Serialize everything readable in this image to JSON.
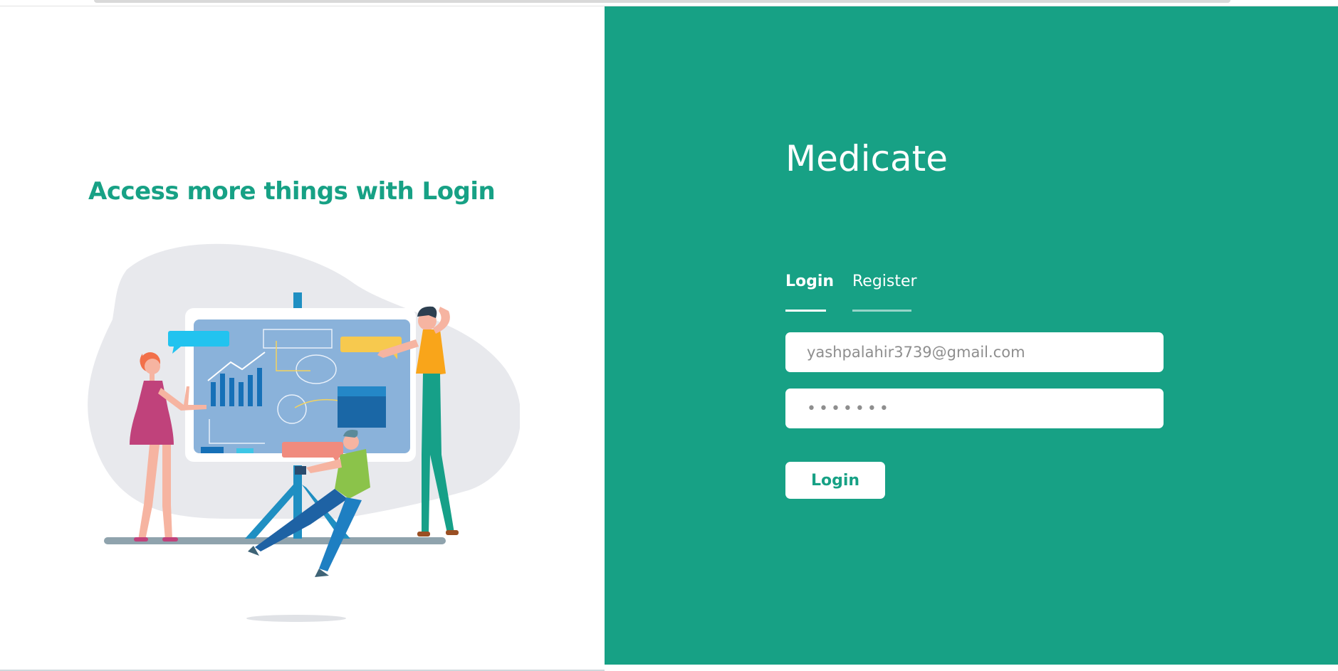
{
  "left": {
    "headline": "Access more things with Login"
  },
  "right": {
    "brand": "Medicate",
    "tabs": [
      {
        "label": "Login",
        "active": true
      },
      {
        "label": "Register",
        "active": false
      }
    ],
    "email_value": "yashpalahir3739@gmail.com",
    "password_value": "•••••••",
    "submit_label": "Login"
  },
  "colors": {
    "accent": "#17a185",
    "background": "#ffffff"
  }
}
